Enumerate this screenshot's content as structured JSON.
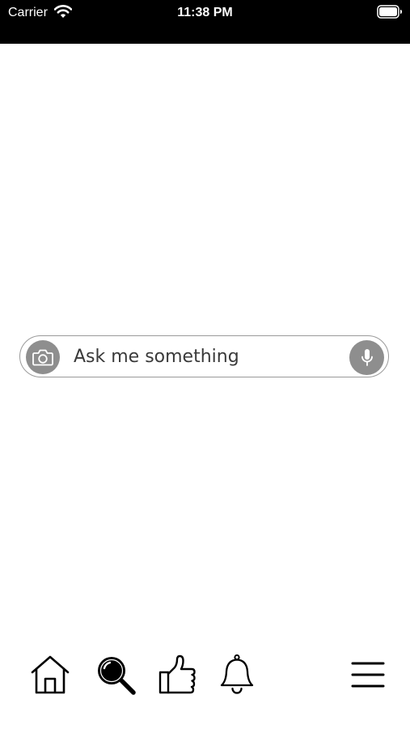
{
  "status_bar": {
    "carrier": "Carrier",
    "time": "11:38 PM",
    "icons": [
      "wifi-icon",
      "battery-icon"
    ]
  },
  "ask_bar": {
    "placeholder": "Ask me something",
    "left_icon": "camera-icon",
    "right_icon": "microphone-icon"
  },
  "tab_bar": {
    "items": [
      "home-icon",
      "search-icon",
      "thumbs-up-icon",
      "bell-icon",
      "menu-icon"
    ]
  },
  "colors": {
    "status_bar_bg": "#000000",
    "icon_button_bg": "#8e8e8e",
    "border": "#9a9a9a",
    "text": "#3a3a3a"
  }
}
